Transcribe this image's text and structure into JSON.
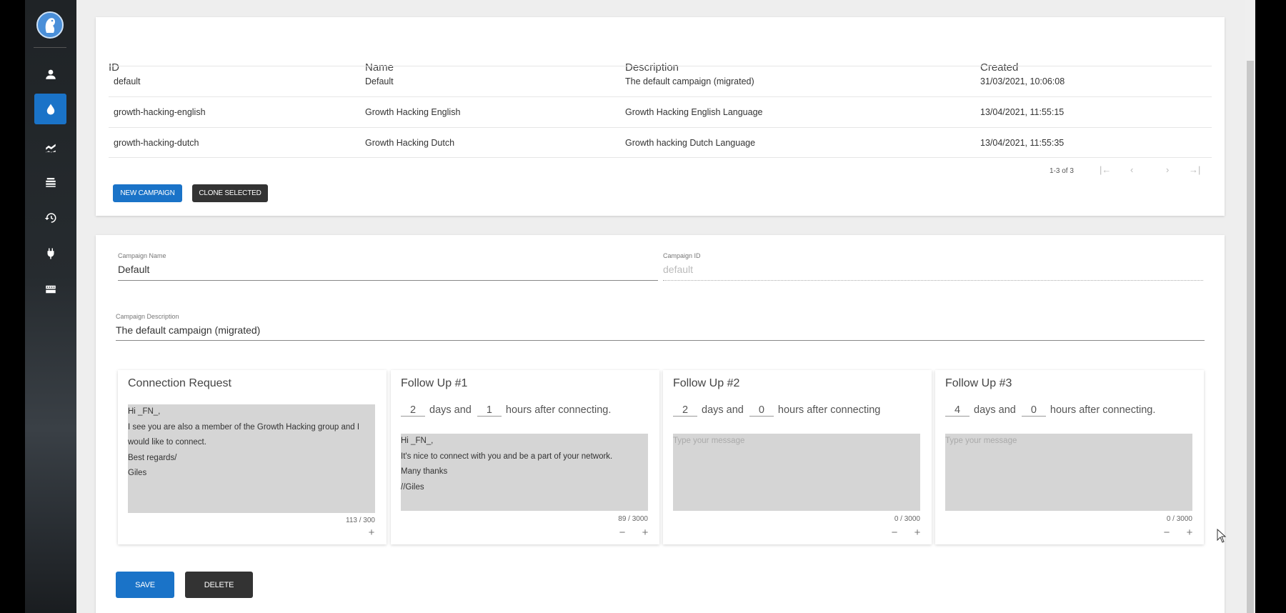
{
  "sidebar": {
    "items": [
      {
        "icon": "person-icon"
      },
      {
        "icon": "water-drop-icon",
        "active": true
      },
      {
        "icon": "chart-area-icon"
      },
      {
        "icon": "list-stack-icon"
      },
      {
        "icon": "history-icon"
      },
      {
        "icon": "plug-icon"
      },
      {
        "icon": "inbox-tray-icon"
      }
    ]
  },
  "campaigns": {
    "columns": [
      "ID",
      "Name",
      "Description",
      "Created"
    ],
    "rows": [
      {
        "id": "default",
        "name": "Default",
        "description": "The default campaign (migrated)",
        "created": "31/03/2021, 10:06:08"
      },
      {
        "id": "growth-hacking-english",
        "name": "Growth Hacking English",
        "description": "Growth Hacking English Language",
        "created": "13/04/2021, 11:55:15"
      },
      {
        "id": "growth-hacking-dutch",
        "name": "Growth Hacking Dutch",
        "description": "Growth hacking Dutch Language",
        "created": "13/04/2021, 11:55:35"
      }
    ],
    "pager": {
      "range": "1-3 of 3",
      "first": "|←",
      "prev": "‹",
      "next": "›",
      "last": "→|"
    },
    "new_label": "NEW CAMPAIGN",
    "clone_label": "CLONE SELECTED"
  },
  "form": {
    "name_label": "Campaign Name",
    "name_value": "Default",
    "id_label": "Campaign ID",
    "id_value": "default",
    "desc_label": "Campaign Description",
    "desc_value": "The default campaign (migrated)",
    "save_label": "SAVE",
    "delete_label": "DELETE"
  },
  "messages": [
    {
      "title": "Connection Request",
      "text": "Hi _FN_,\nI see you are also a member of the Growth Hacking group and I would like to connect.\nBest regards/\nGiles",
      "counter": "113 / 300"
    },
    {
      "title": "Follow Up #1",
      "days": "2",
      "days_text": "days and",
      "hours": "1",
      "hours_text": "hours after connecting.",
      "text": "Hi _FN_,\nIt's nice to connect with you and be a part of your network.\nMany thanks\n//Giles",
      "counter": "89 / 3000"
    },
    {
      "title": "Follow Up #2",
      "days": "2",
      "days_text": "days and",
      "hours": "0",
      "hours_text": "hours after connecting",
      "placeholder": "Type your message",
      "counter": "0 / 3000"
    },
    {
      "title": "Follow Up #3",
      "days": "4",
      "days_text": "days and",
      "hours": "0",
      "hours_text": "hours after connecting.",
      "placeholder": "Type your message",
      "counter": "0 / 3000"
    }
  ],
  "controls": {
    "minus": "−",
    "plus": "+"
  }
}
